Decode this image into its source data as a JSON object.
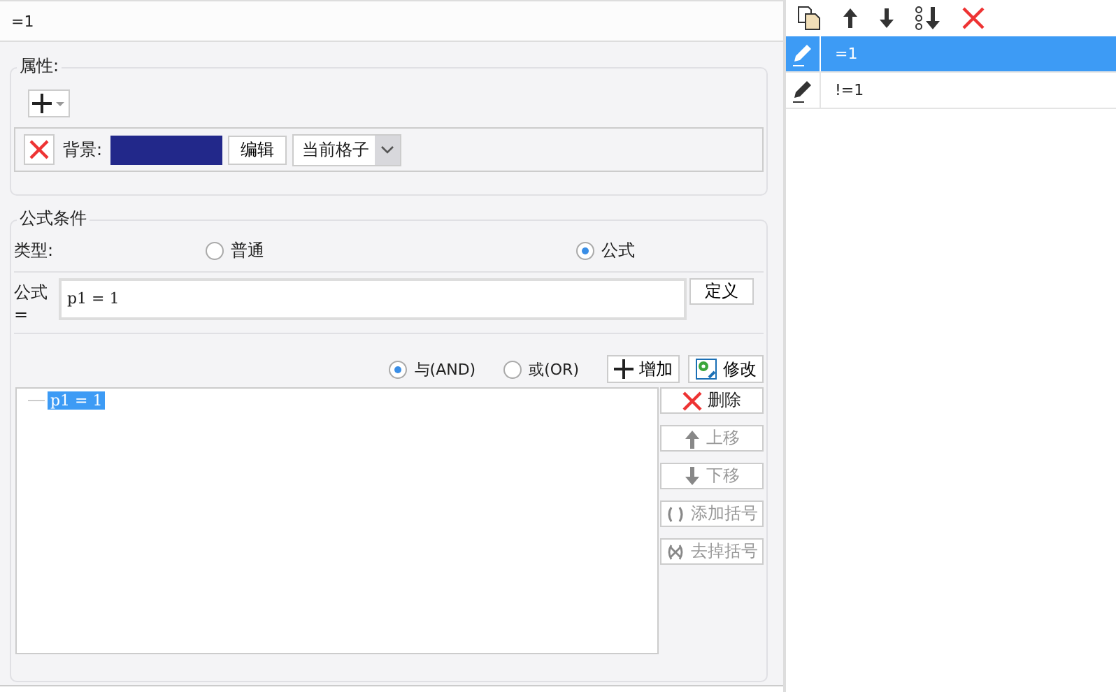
{
  "name_field": {
    "value": "=1"
  },
  "properties": {
    "title": "属性:",
    "background": {
      "label": "背景:",
      "color": "#22288a",
      "edit_button": "编辑",
      "scope": "当前格子"
    }
  },
  "formula_condition": {
    "title": "公式条件",
    "type_label": "类型:",
    "types": [
      {
        "label": "普通",
        "selected": false
      },
      {
        "label": "公式",
        "selected": true
      }
    ],
    "formula_label": "公式=",
    "formula_value": "p1 = 1",
    "define_button": "定义",
    "logic": [
      {
        "label": "与(AND)",
        "selected": true
      },
      {
        "label": "或(OR)",
        "selected": false
      }
    ],
    "add_button": "增加",
    "modify_button": "修改",
    "tree": [
      {
        "label": "p1 = 1",
        "selected": true
      }
    ],
    "actions": [
      {
        "kind": "delete",
        "label": "删除",
        "disabled": false
      },
      {
        "kind": "up",
        "label": "上移",
        "disabled": true
      },
      {
        "kind": "down",
        "label": "下移",
        "disabled": true
      },
      {
        "kind": "add-paren",
        "label": "添加括号",
        "disabled": true
      },
      {
        "kind": "remove-paren",
        "label": "去掉括号",
        "disabled": true
      }
    ]
  },
  "conditions": [
    {
      "label": "=1",
      "selected": true
    },
    {
      "label": "!=1",
      "selected": false
    }
  ]
}
